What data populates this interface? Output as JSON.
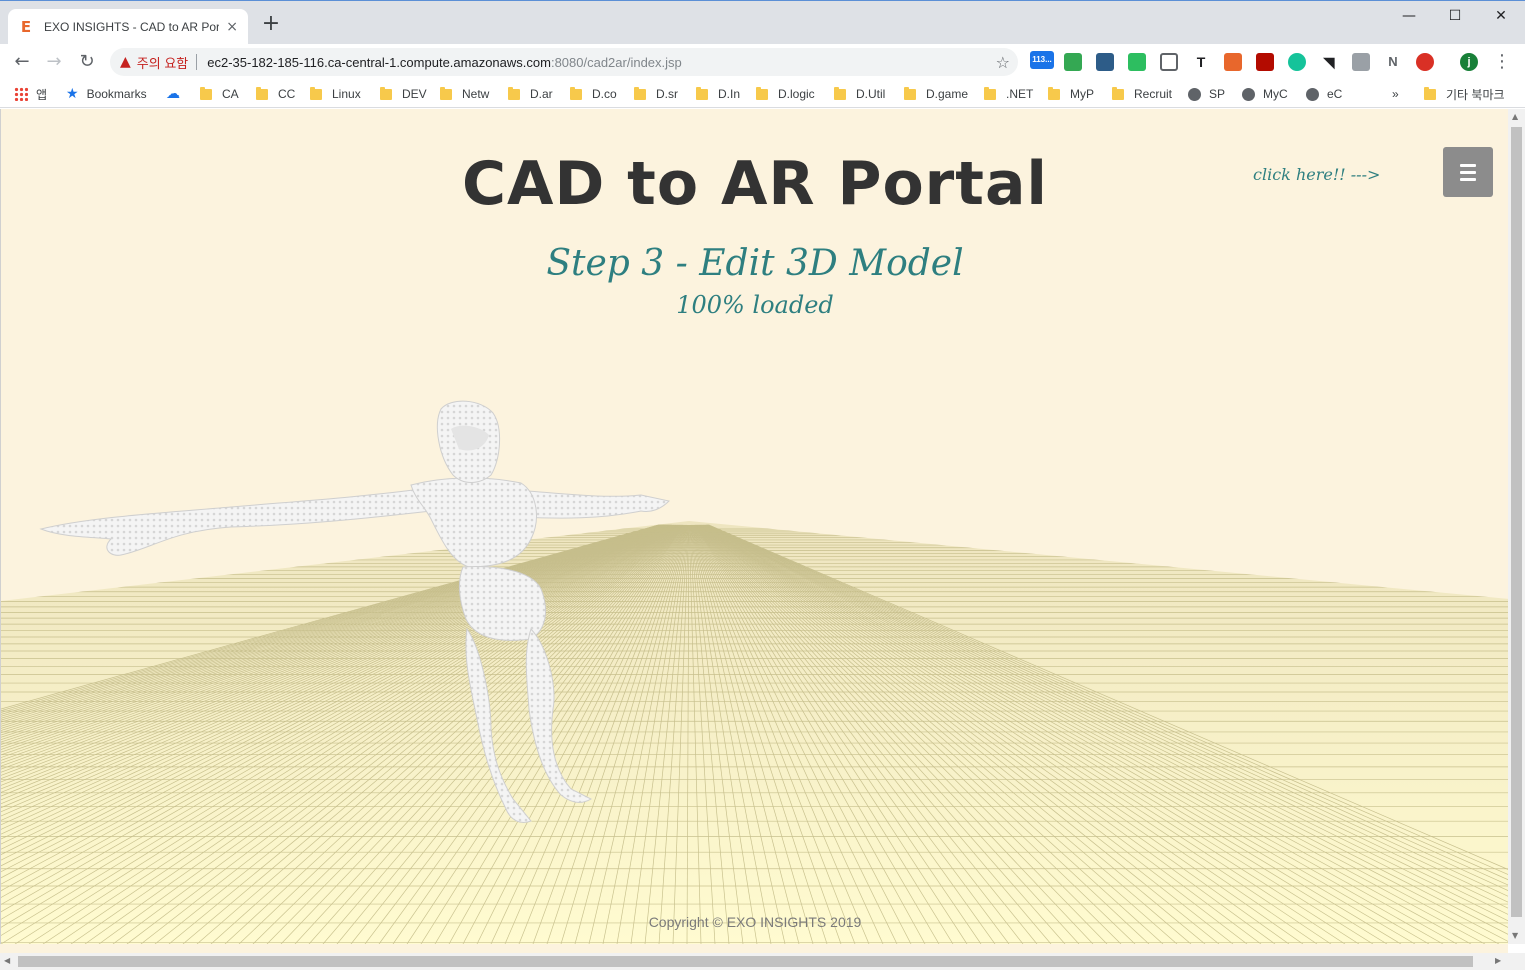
{
  "browser": {
    "tab_title": "EXO INSIGHTS - CAD to AR Portal",
    "tab_favicon": "E",
    "new_tab": "+",
    "close_tab": "×",
    "window_controls": {
      "minimize": "—",
      "maximize": "☐",
      "close": "✕"
    },
    "security_label": "주의 요함",
    "url_host": "ec2-35-182-185-116.ca-central-1.compute.amazonaws.com",
    "url_path": ":8080/cad2ar/index.jsp",
    "extension_badge": "113...",
    "bookmarks": [
      {
        "label": "앱",
        "icon": "apps-icon"
      },
      {
        "label": "Bookmarks",
        "icon": "star-icon"
      },
      {
        "label": "",
        "icon": "cloud-icon"
      },
      {
        "label": "CA",
        "icon": "folder-icon"
      },
      {
        "label": "CC",
        "icon": "folder-icon"
      },
      {
        "label": "Linux",
        "icon": "folder-icon"
      },
      {
        "label": "DEV",
        "icon": "folder-icon"
      },
      {
        "label": "Netw",
        "icon": "folder-icon"
      },
      {
        "label": "D.ar",
        "icon": "folder-icon"
      },
      {
        "label": "D.co",
        "icon": "folder-icon"
      },
      {
        "label": "D.sr",
        "icon": "folder-icon"
      },
      {
        "label": "D.In",
        "icon": "folder-icon"
      },
      {
        "label": "D.logic",
        "icon": "folder-icon"
      },
      {
        "label": "D.Util",
        "icon": "folder-icon"
      },
      {
        "label": "D.game",
        "icon": "folder-icon"
      },
      {
        "label": ".NET",
        "icon": "folder-icon"
      },
      {
        "label": "MyP",
        "icon": "folder-icon"
      },
      {
        "label": "Recruit",
        "icon": "folder-icon"
      },
      {
        "label": "SP",
        "icon": "globe-icon"
      },
      {
        "label": "MyC",
        "icon": "globe-icon"
      },
      {
        "label": "eC",
        "icon": "globe-icon"
      }
    ],
    "bookmarks_overflow": "»",
    "other_bookmarks": "기타 북마크"
  },
  "page": {
    "title": "CAD to AR Portal",
    "step": "Step 3 - Edit 3D Model",
    "status": "100% loaded",
    "click_hint": "click here!! --->",
    "copyright": "Copyright © EXO INSIGHTS 2019"
  },
  "colors": {
    "background": "#fcf3de",
    "accent": "#2e7f80",
    "title": "#333333",
    "menu_button": "#8c8c8c",
    "floor": "#fdf6c8",
    "grid": "#b8b07a"
  }
}
